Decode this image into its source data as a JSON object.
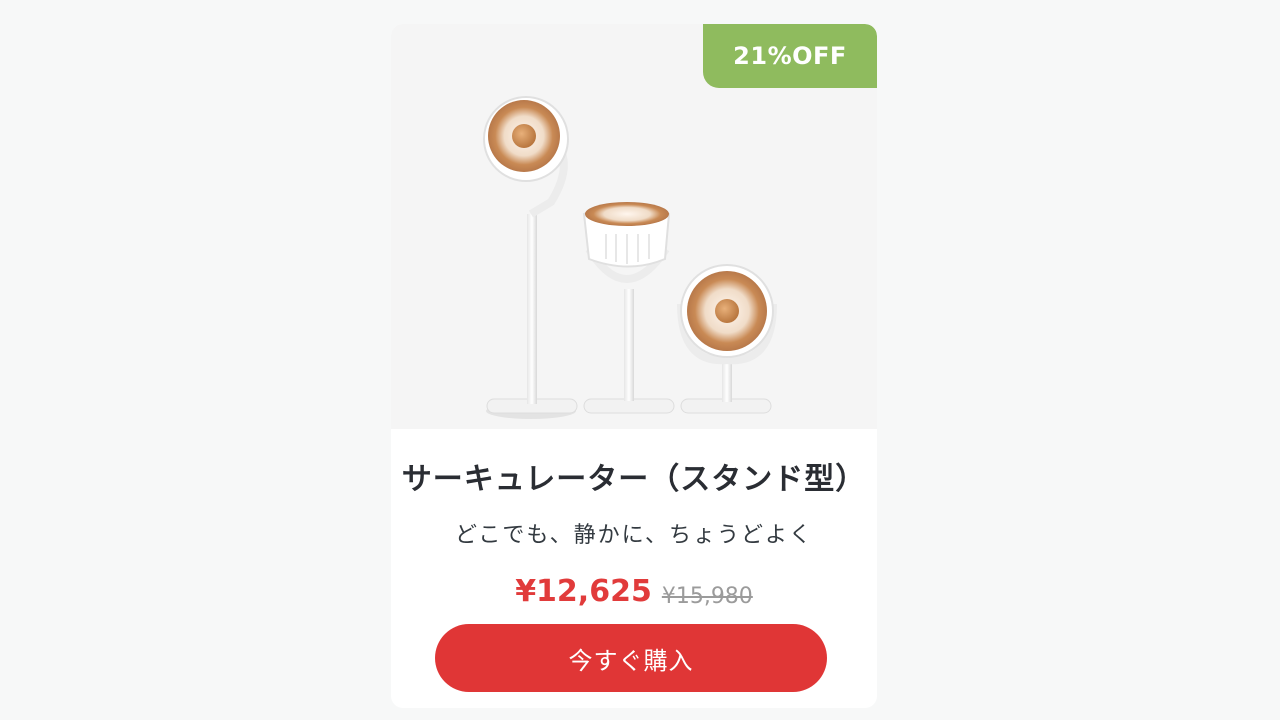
{
  "product": {
    "discount_badge": "21%OFF",
    "title": "サーキュレーター（スタンド型）",
    "tagline": "どこでも、静かに、ちょうどよく",
    "price_current": "¥12,625",
    "price_original": "¥15,980",
    "buy_label": "今すぐ購入",
    "image_icon": "circulator-fans-image"
  },
  "colors": {
    "badge": "#8fbb5e",
    "price": "#e13b3b",
    "button": "#e03636",
    "fan_accent": "#c98a55"
  }
}
